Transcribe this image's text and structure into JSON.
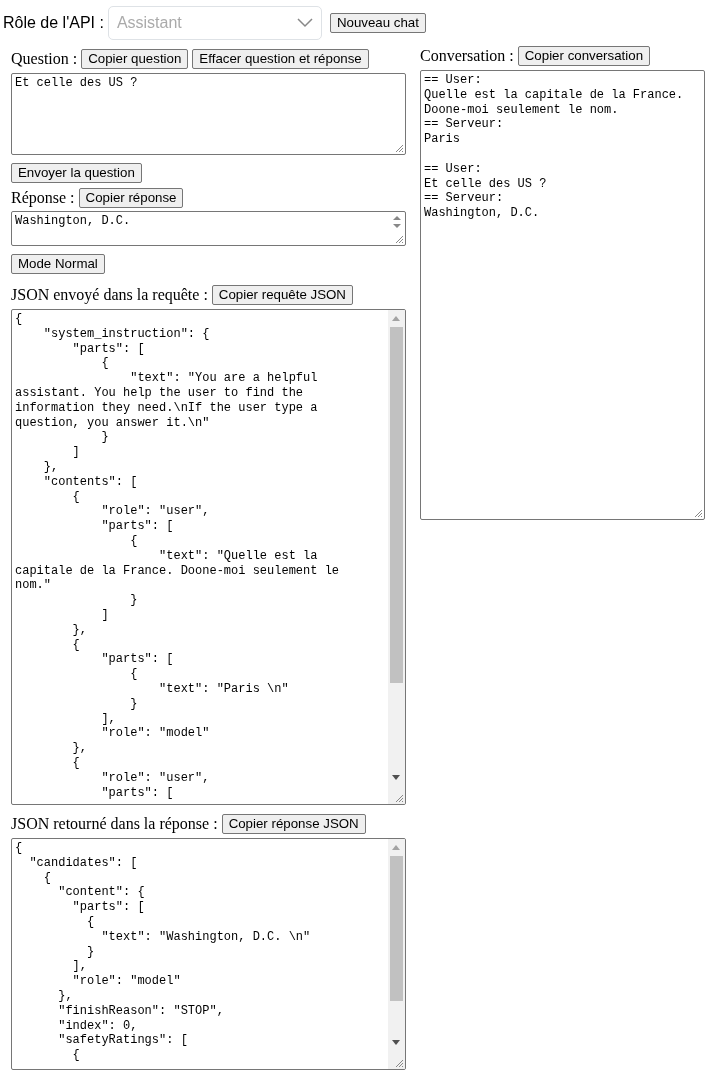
{
  "api_role": {
    "label": "Rôle de l'API :",
    "value": "Assistant"
  },
  "new_chat_button": "Nouveau chat",
  "question": {
    "label": "Question :",
    "buttons": [
      "Copier question",
      "Effacer question et réponse"
    ],
    "lines": [
      "Et celle des US ?"
    ]
  },
  "send_button": "Envoyer la question",
  "answer": {
    "label": "Réponse :",
    "buttons": [
      "Copier réponse"
    ],
    "lines": [
      "Washington, D.C."
    ]
  },
  "mode_button": "Mode Normal",
  "request_json": {
    "label": "JSON envoyé dans la requête :",
    "buttons": [
      "Copier requête JSON"
    ],
    "lines": [
      "{",
      "    \"system_instruction\": {",
      "        \"parts\": [",
      "            {",
      "                \"text\": \"You are a helpful",
      "assistant. You help the user to find the",
      "information they need.\\nIf the user type a",
      "question, you answer it.\\n\"",
      "            }",
      "        ]",
      "    },",
      "    \"contents\": [",
      "        {",
      "            \"role\": \"user\",",
      "            \"parts\": [",
      "                {",
      "                    \"text\": \"Quelle est la",
      "capitale de la France. Doone-moi seulement le",
      "nom.\"",
      "                }",
      "            ]",
      "        },",
      "        {",
      "            \"parts\": [",
      "                {",
      "                    \"text\": \"Paris \\n\"",
      "                }",
      "            ],",
      "            \"role\": \"model\"",
      "        },",
      "        {",
      "            \"role\": \"user\",",
      "            \"parts\": ["
    ]
  },
  "response_json": {
    "label": "JSON retourné dans la réponse :",
    "buttons": [
      "Copier réponse JSON"
    ],
    "lines": [
      "{",
      "  \"candidates\": [",
      "    {",
      "      \"content\": {",
      "        \"parts\": [",
      "          {",
      "            \"text\": \"Washington, D.C. \\n\"",
      "          }",
      "        ],",
      "        \"role\": \"model\"",
      "      },",
      "      \"finishReason\": \"STOP\",",
      "      \"index\": 0,",
      "      \"safetyRatings\": [",
      "        {"
    ]
  },
  "conversation": {
    "label": "Conversation :",
    "buttons": [
      "Copier conversation"
    ],
    "blocks": [
      [
        "== User:",
        "Quelle est la capitale de la France.",
        "Doone-moi seulement le nom.",
        "== Serveur:",
        "Paris"
      ],
      [
        "== User:",
        "Et celle des US ?",
        "== Serveur:",
        "Washington, D.C."
      ]
    ]
  }
}
